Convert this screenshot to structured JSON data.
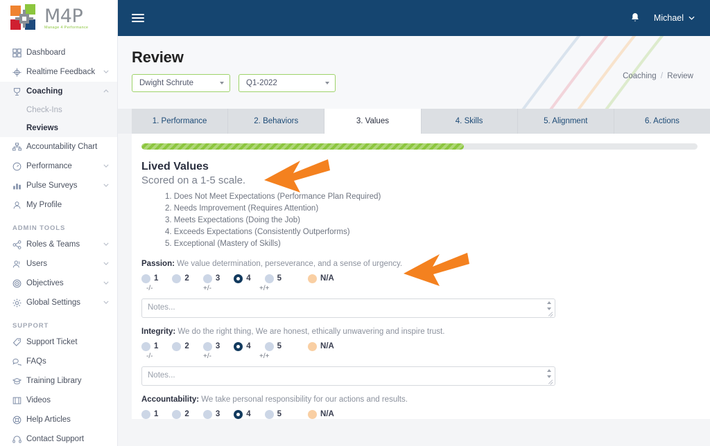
{
  "brand": {
    "name": "M4P",
    "tagline": "Manage 4 Performance"
  },
  "topbar": {
    "menu_icon": "hamburger-icon",
    "bell_icon": "bell-icon",
    "user_name": "Michael",
    "user_chevron": "chevron-down-icon"
  },
  "sidebar": {
    "items": [
      {
        "label": "Dashboard",
        "icon": "grid-icon",
        "chevron": ""
      },
      {
        "label": "Realtime Feedback",
        "icon": "target-icon",
        "chevron": "v"
      },
      {
        "label": "Coaching",
        "icon": "trophy-icon",
        "chevron": "^"
      }
    ],
    "coaching_children": [
      {
        "label": "Check-Ins"
      },
      {
        "label": "Reviews"
      }
    ],
    "items_after": [
      {
        "label": "Accountability Chart",
        "icon": "org-chart-icon",
        "chevron": ""
      },
      {
        "label": "Performance",
        "icon": "gauge-icon",
        "chevron": "v"
      },
      {
        "label": "Pulse Surveys",
        "icon": "bar-chart-icon",
        "chevron": "v"
      },
      {
        "label": "My Profile",
        "icon": "person-icon",
        "chevron": ""
      }
    ],
    "admin_section": "ADMIN TOOLS",
    "admin_items": [
      {
        "label": "Roles & Teams",
        "icon": "share-icon",
        "chevron": "v"
      },
      {
        "label": "Users",
        "icon": "people-icon",
        "chevron": "v"
      },
      {
        "label": "Objectives",
        "icon": "target-rings-icon",
        "chevron": "v"
      },
      {
        "label": "Global Settings",
        "icon": "gear-icon",
        "chevron": "v"
      }
    ],
    "support_section": "SUPPORT",
    "support_items": [
      {
        "label": "Support Ticket",
        "icon": "tag-icon"
      },
      {
        "label": "FAQs",
        "icon": "chat-icon"
      },
      {
        "label": "Training Library",
        "icon": "graduation-cap-icon"
      },
      {
        "label": "Videos",
        "icon": "video-icon"
      },
      {
        "label": "Help Articles",
        "icon": "life-ring-icon"
      },
      {
        "label": "Contact Support",
        "icon": "headset-icon"
      }
    ]
  },
  "page": {
    "title": "Review",
    "employee_select": "Dwight Schrute",
    "period_select": "Q1-2022",
    "breadcrumb_parent": "Coaching",
    "breadcrumb_sep": "/",
    "breadcrumb_current": "Review"
  },
  "tabs": [
    {
      "label": "1. Performance",
      "active": false
    },
    {
      "label": "2. Behaviors",
      "active": false
    },
    {
      "label": "3. Values",
      "active": true
    },
    {
      "label": "4. Skills",
      "active": false
    },
    {
      "label": "5. Alignment",
      "active": false
    },
    {
      "label": "6. Actions",
      "active": false
    }
  ],
  "progress": {
    "percent": 58
  },
  "section": {
    "title": "Lived Values",
    "subtitle": "Scored on a 1-5 scale.",
    "scale": [
      "1. Does Not Meet Expectations (Performance Plan Required)",
      "2. Needs Improvement (Requires Attention)",
      "3. Meets Expectations (Doing the Job)",
      "4. Exceeds Expectations (Consistently Outperforms)",
      "5. Exceptional (Mastery of Skills)"
    ]
  },
  "rating_options": [
    "1",
    "2",
    "3",
    "4",
    "5"
  ],
  "na_label": "N/A",
  "sublabels": [
    "-/-",
    "+/-",
    "+/+"
  ],
  "notes_placeholder": "Notes...",
  "criteria": [
    {
      "name": "Passion:",
      "description": "We value determination, perseverance, and a sense of urgency.",
      "selected": "4",
      "notes_value": ""
    },
    {
      "name": "Integrity:",
      "description": "We do the right thing, We are honest, ethically unwavering and inspire trust.",
      "selected": "4",
      "notes_value": ""
    },
    {
      "name": "Accountability:",
      "description": "We take personal responsibility for our actions and results.",
      "selected": "4",
      "notes_value": ""
    }
  ],
  "colors": {
    "header_navy": "#154570",
    "brand_green": "#8cc63e",
    "accent_orange": "#f4811f",
    "selected_radio": "#123a5e",
    "na_radio": "#f9cfa3"
  },
  "annotations": [
    {
      "name": "arrow-to-lived-values"
    },
    {
      "name": "arrow-to-passion-rating"
    }
  ]
}
